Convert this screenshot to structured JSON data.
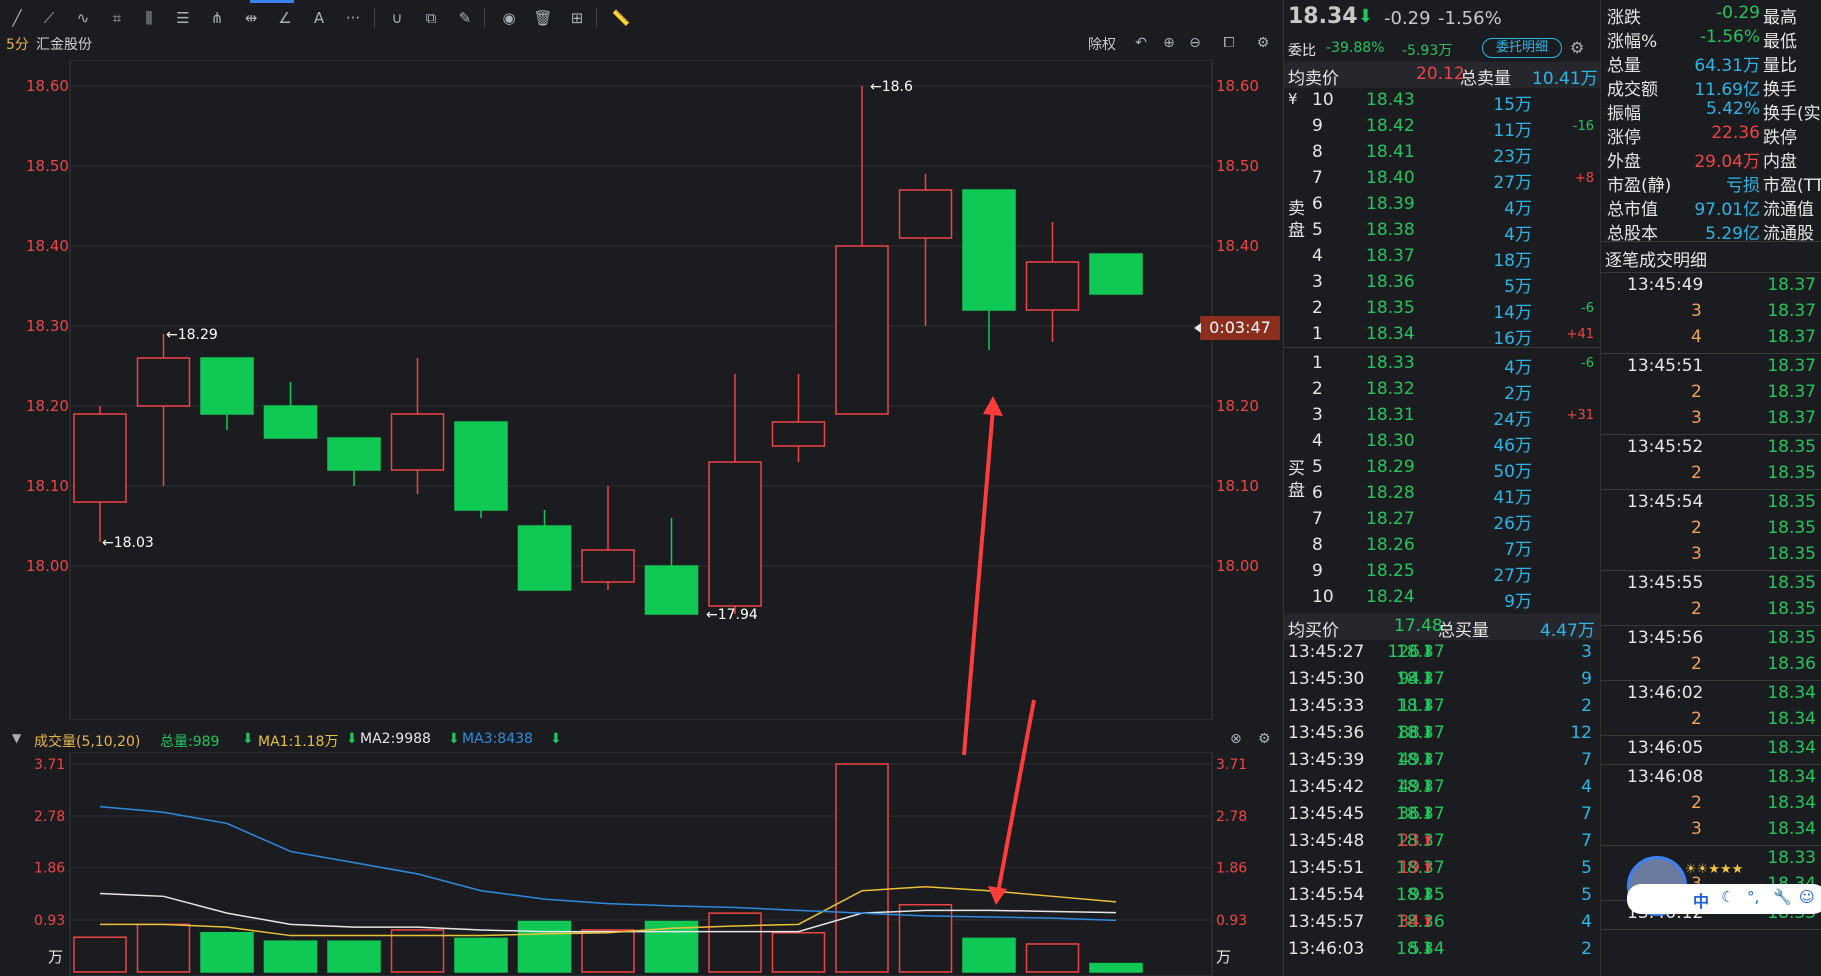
{
  "toolbar": {
    "icons": [
      "line-tool",
      "segment-tool",
      "path-tool",
      "crop-tool",
      "fib-tool",
      "channel-tool",
      "pitchfork-tool",
      "range-tool",
      "trend-angle-tool",
      "text-tool",
      "more-tools",
      "magnet-tool",
      "layers-tool",
      "pencil-tool",
      "eye-tool",
      "delete-tool",
      "grid-tool",
      "ruler-tool"
    ],
    "more_label": "···",
    "text_label": "A"
  },
  "chart": {
    "period": "5分",
    "stock_name": "汇金股份",
    "chuquan": "除权",
    "countdown": "0:03:47",
    "price_axis": [
      "18.60",
      "18.50",
      "18.40",
      "18.30",
      "18.20",
      "18.10",
      "18.00"
    ],
    "ann_high": "←18.6",
    "ann_1829": "←18.29",
    "ann_1803": "←18.03",
    "ann_1794": "←17.94",
    "up_color": "#ef4444",
    "down_color": "#10c955"
  },
  "volume": {
    "title": "成交量(5,10,20)",
    "total": "总量:989",
    "ma1": "MA1:1.18万",
    "ma2": "MA2:9988",
    "ma3": "MA3:8438",
    "axis": [
      "3.71",
      "2.78",
      "1.86",
      "0.93"
    ],
    "unit": "万"
  },
  "chart_data": {
    "type": "candlestick",
    "candles": [
      {
        "o": 18.08,
        "h": 18.2,
        "l": 18.03,
        "c": 18.19
      },
      {
        "o": 18.2,
        "h": 18.29,
        "l": 18.1,
        "c": 18.26
      },
      {
        "o": 18.26,
        "h": 18.26,
        "l": 18.17,
        "c": 18.19
      },
      {
        "o": 18.2,
        "h": 18.23,
        "l": 18.16,
        "c": 18.16
      },
      {
        "o": 18.16,
        "h": 18.16,
        "l": 18.1,
        "c": 18.12
      },
      {
        "o": 18.12,
        "h": 18.26,
        "l": 18.09,
        "c": 18.19
      },
      {
        "o": 18.18,
        "h": 18.18,
        "l": 18.06,
        "c": 18.07
      },
      {
        "o": 18.05,
        "h": 18.07,
        "l": 17.97,
        "c": 17.97
      },
      {
        "o": 17.98,
        "h": 18.1,
        "l": 17.97,
        "c": 18.02
      },
      {
        "o": 18.0,
        "h": 18.06,
        "l": 17.94,
        "c": 17.94
      },
      {
        "o": 17.95,
        "h": 18.24,
        "l": 17.94,
        "c": 18.13
      },
      {
        "o": 18.15,
        "h": 18.24,
        "l": 18.13,
        "c": 18.18
      },
      {
        "o": 18.19,
        "h": 18.6,
        "l": 18.19,
        "c": 18.4
      },
      {
        "o": 18.41,
        "h": 18.49,
        "l": 18.3,
        "c": 18.47
      },
      {
        "o": 18.47,
        "h": 18.47,
        "l": 18.27,
        "c": 18.32
      },
      {
        "o": 18.32,
        "h": 18.43,
        "l": 18.28,
        "c": 18.38
      },
      {
        "o": 18.39,
        "h": 18.39,
        "l": 18.34,
        "c": 18.34
      }
    ],
    "volumes": [
      0.62,
      0.85,
      0.7,
      0.55,
      0.55,
      0.75,
      0.6,
      0.9,
      0.75,
      0.9,
      1.05,
      0.7,
      3.71,
      1.2,
      0.6,
      0.5,
      0.15
    ],
    "ma_lines": {
      "white": [
        1.4,
        1.35,
        1.05,
        0.85,
        0.8,
        0.8,
        0.75,
        0.72,
        0.72,
        0.72,
        0.72,
        0.72,
        1.05,
        1.1,
        1.1,
        1.08,
        1.06
      ],
      "yellow": [
        0.85,
        0.85,
        0.8,
        0.65,
        0.65,
        0.65,
        0.65,
        0.68,
        0.7,
        0.78,
        0.82,
        0.85,
        1.45,
        1.52,
        1.45,
        1.35,
        1.25
      ],
      "blue": [
        2.95,
        2.85,
        2.65,
        2.15,
        1.95,
        1.75,
        1.45,
        1.3,
        1.22,
        1.18,
        1.15,
        1.1,
        1.05,
        1.0,
        0.98,
        0.96,
        0.92
      ]
    },
    "price_range": [
      17.94,
      18.6
    ],
    "volume_range": [
      0,
      3.71
    ]
  },
  "quote": {
    "price": "18.34",
    "change": "-0.29",
    "change_pct": "-1.56%",
    "weibi_label": "委比",
    "weibi_pct": "-39.88%",
    "weibi_amt": "-5.93万",
    "entrust_btn": "委托明细",
    "avg_sell_label": "均卖价",
    "avg_sell": "20.12",
    "total_sell_label": "总卖量",
    "total_sell": "10.41万",
    "sell_side_label": "卖盘",
    "buy_side_label": "买盘",
    "yen": "¥",
    "sells": [
      {
        "lv": "10",
        "p": "18.43",
        "v": "15万",
        "d": ""
      },
      {
        "lv": "9",
        "p": "18.42",
        "v": "11万",
        "d": "-16"
      },
      {
        "lv": "8",
        "p": "18.41",
        "v": "23万",
        "d": ""
      },
      {
        "lv": "7",
        "p": "18.40",
        "v": "27万",
        "d": "+8"
      },
      {
        "lv": "6",
        "p": "18.39",
        "v": "4万",
        "d": ""
      },
      {
        "lv": "5",
        "p": "18.38",
        "v": "4万",
        "d": ""
      },
      {
        "lv": "4",
        "p": "18.37",
        "v": "18万",
        "d": ""
      },
      {
        "lv": "3",
        "p": "18.36",
        "v": "5万",
        "d": ""
      },
      {
        "lv": "2",
        "p": "18.35",
        "v": "14万",
        "d": "-6"
      },
      {
        "lv": "1",
        "p": "18.34",
        "v": "16万",
        "d": "+41"
      }
    ],
    "buys": [
      {
        "lv": "1",
        "p": "18.33",
        "v": "4万",
        "d": "-6"
      },
      {
        "lv": "2",
        "p": "18.32",
        "v": "2万",
        "d": ""
      },
      {
        "lv": "3",
        "p": "18.31",
        "v": "24万",
        "d": "+31"
      },
      {
        "lv": "4",
        "p": "18.30",
        "v": "46万",
        "d": ""
      },
      {
        "lv": "5",
        "p": "18.29",
        "v": "50万",
        "d": ""
      },
      {
        "lv": "6",
        "p": "18.28",
        "v": "41万",
        "d": ""
      },
      {
        "lv": "7",
        "p": "18.27",
        "v": "26万",
        "d": ""
      },
      {
        "lv": "8",
        "p": "18.26",
        "v": "7万",
        "d": ""
      },
      {
        "lv": "9",
        "p": "18.25",
        "v": "27万",
        "d": ""
      },
      {
        "lv": "10",
        "p": "18.24",
        "v": "9万",
        "d": ""
      }
    ],
    "avg_buy_label": "均买价",
    "avg_buy": "17.48",
    "total_buy_label": "总买量",
    "total_buy": "4.47万",
    "ticks": [
      {
        "t": "13:45:27",
        "p": "18.37",
        "v": "126",
        "dir": "down",
        "n": "3"
      },
      {
        "t": "13:45:30",
        "p": "18.37",
        "v": "94",
        "dir": "down",
        "n": "9"
      },
      {
        "t": "13:45:33",
        "p": "18.37",
        "v": "11",
        "dir": "down",
        "n": "2"
      },
      {
        "t": "13:45:36",
        "p": "18.37",
        "v": "88",
        "dir": "down",
        "n": "12"
      },
      {
        "t": "13:45:39",
        "p": "18.37",
        "v": "49",
        "dir": "down",
        "n": "7"
      },
      {
        "t": "13:45:42",
        "p": "18.37",
        "v": "49",
        "dir": "down",
        "n": "4"
      },
      {
        "t": "13:45:45",
        "p": "18.37",
        "v": "36",
        "dir": "down",
        "n": "7"
      },
      {
        "t": "13:45:48",
        "p": "18.37",
        "v": "23",
        "dir": "up",
        "n": "7"
      },
      {
        "t": "13:45:51",
        "p": "18.37",
        "v": "19",
        "dir": "up",
        "n": "5"
      },
      {
        "t": "13:45:54",
        "p": "18.35",
        "v": "9",
        "dir": "down",
        "n": "5"
      },
      {
        "t": "13:45:57",
        "p": "18.36",
        "v": "34",
        "dir": "up",
        "n": "4"
      },
      {
        "t": "13:46:03",
        "p": "18.34",
        "v": "5",
        "dir": "down",
        "n": "2"
      }
    ]
  },
  "stats": [
    {
      "l": "涨跌",
      "v": "-0.29",
      "r": "最高",
      "c": "green"
    },
    {
      "l": "涨幅%",
      "v": "-1.56%",
      "r": "最低",
      "c": "green"
    },
    {
      "l": "总量",
      "v": "64.31万",
      "r": "量比",
      "c": "cyan"
    },
    {
      "l": "成交额",
      "v": "11.69亿",
      "r": "换手",
      "c": "cyan"
    },
    {
      "l": "振幅",
      "v": "5.42%",
      "r": "换手(实)",
      "c": "cyan"
    },
    {
      "l": "涨停",
      "v": "22.36",
      "r": "跌停",
      "c": "red"
    },
    {
      "l": "外盘",
      "v": "29.04万",
      "r": "内盘",
      "c": "red"
    },
    {
      "l": "市盈(静)",
      "v": "亏损",
      "r": "市盈(TTM)",
      "c": "cyan"
    },
    {
      "l": "总市值",
      "v": "97.01亿",
      "r": "流通值",
      "c": "cyan"
    },
    {
      "l": "总股本",
      "v": "5.29亿",
      "r": "流通股",
      "c": "cyan"
    }
  ],
  "trades": {
    "title": "逐笔成交明细",
    "groups": [
      {
        "t": "13:45:49",
        "rows": [
          {
            "q": "",
            "p": "18.37"
          },
          {
            "q": "3",
            "p": "18.37"
          },
          {
            "q": "4",
            "p": "18.37"
          }
        ]
      },
      {
        "t": "13:45:51",
        "rows": [
          {
            "q": "",
            "p": "18.37"
          },
          {
            "q": "2",
            "p": "18.37"
          },
          {
            "q": "3",
            "p": "18.37"
          }
        ]
      },
      {
        "t": "13:45:52",
        "rows": [
          {
            "q": "",
            "p": "18.35"
          },
          {
            "q": "2",
            "p": "18.35"
          }
        ]
      },
      {
        "t": "13:45:54",
        "rows": [
          {
            "q": "",
            "p": "18.35"
          },
          {
            "q": "2",
            "p": "18.35"
          },
          {
            "q": "3",
            "p": "18.35"
          }
        ]
      },
      {
        "t": "13:45:55",
        "rows": [
          {
            "q": "",
            "p": "18.35"
          },
          {
            "q": "2",
            "p": "18.35"
          }
        ]
      },
      {
        "t": "13:45:56",
        "rows": [
          {
            "q": "",
            "p": "18.35"
          },
          {
            "q": "2",
            "p": "18.36"
          }
        ]
      },
      {
        "t": "13:46:02",
        "rows": [
          {
            "q": "",
            "p": "18.34"
          },
          {
            "q": "2",
            "p": "18.34"
          }
        ]
      },
      {
        "t": "13:46:05",
        "rows": [
          {
            "q": "",
            "p": "18.34"
          }
        ]
      },
      {
        "t": "13:46:08",
        "rows": [
          {
            "q": "",
            "p": "18.34"
          },
          {
            "q": "2",
            "p": "18.34"
          },
          {
            "q": "3",
            "p": "18.34"
          }
        ]
      },
      {
        "t": "",
        "rows": [
          {
            "q": "",
            "p": "18.33"
          },
          {
            "q": "3",
            "p": "18.34"
          }
        ]
      },
      {
        "t": "13:46:12",
        "rows": [
          {
            "q": "",
            "p": "18.33"
          }
        ]
      }
    ]
  },
  "ime": {
    "label": "中"
  }
}
